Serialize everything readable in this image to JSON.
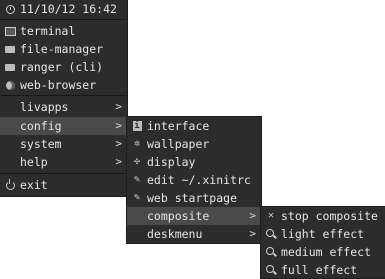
{
  "root_menu": {
    "header": "11/10/12 16:42",
    "apps": [
      "terminal",
      "file-manager",
      "ranger (cli)",
      "web-browser"
    ],
    "submenus": [
      "livapps",
      "config",
      "system",
      "help"
    ],
    "exit": "exit"
  },
  "config_menu": {
    "items": [
      "interface",
      "wallpaper",
      "display",
      "edit ~/.xinitrc",
      "web startpage",
      "composite",
      "deskmenu"
    ]
  },
  "composite_menu": {
    "items": [
      "stop composite",
      "light effect",
      "medium effect",
      "full effect"
    ]
  },
  "submenu_arrow": ">",
  "colors": {
    "menu_bg": "#2c2c2c",
    "highlight_bg": "#4a4a4a",
    "text": "#e6e6e6"
  }
}
